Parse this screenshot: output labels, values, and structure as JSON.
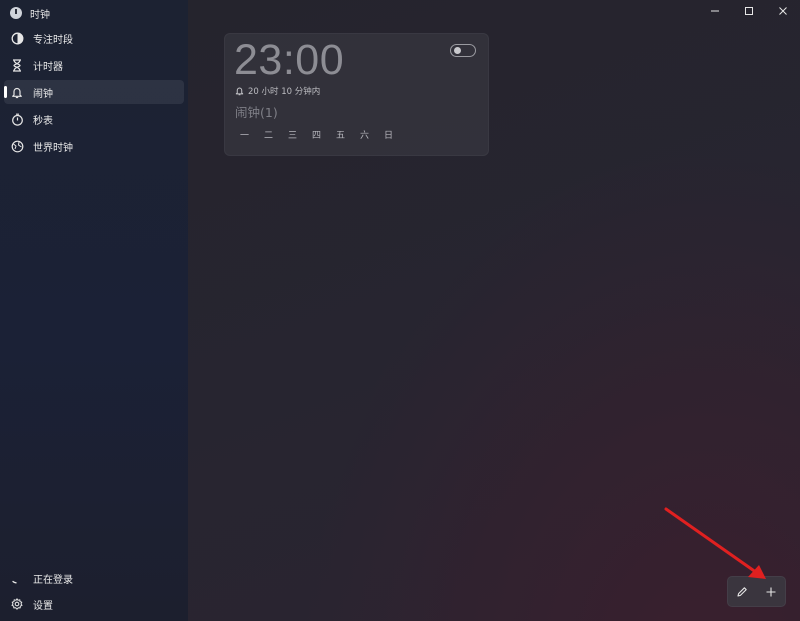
{
  "app": {
    "title": "时钟"
  },
  "window_controls": {
    "minimize": "minimize-icon",
    "maximize": "maximize-icon",
    "close": "close-icon"
  },
  "sidebar": {
    "items": [
      {
        "label": "专注时段",
        "icon": "focus-icon",
        "active": false
      },
      {
        "label": "计时器",
        "icon": "hourglass-icon",
        "active": false
      },
      {
        "label": "闹钟",
        "icon": "bell-icon",
        "active": true
      },
      {
        "label": "秒表",
        "icon": "stopwatch-icon",
        "active": false
      },
      {
        "label": "世界时钟",
        "icon": "globe-icon",
        "active": false
      }
    ],
    "bottom": {
      "signin_label": "正在登录",
      "settings_label": "设置"
    }
  },
  "alarm": {
    "time": "23:00",
    "remaining": "20 小时 10 分钟内",
    "name": "闹钟(1)",
    "days": [
      "一",
      "二",
      "三",
      "四",
      "五",
      "六",
      "日"
    ],
    "enabled": false
  },
  "toolbar": {
    "edit_icon": "pencil-icon",
    "add_icon": "plus-icon"
  },
  "colors": {
    "sidebar_bg": "#1c2134",
    "card_bg": "#3c3c46",
    "arrow": "#e02020"
  }
}
